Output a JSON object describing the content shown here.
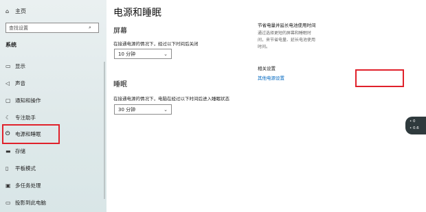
{
  "sidebar": {
    "home": "主页",
    "search_placeholder": "查找设置",
    "section": "系统",
    "items": [
      {
        "label": "显示"
      },
      {
        "label": "声音"
      },
      {
        "label": "通知和操作"
      },
      {
        "label": "专注助手"
      },
      {
        "label": "电源和睡眠"
      },
      {
        "label": "存储"
      },
      {
        "label": "平板模式"
      },
      {
        "label": "多任务处理"
      },
      {
        "label": "投影到此电脑"
      }
    ]
  },
  "main": {
    "title": "电源和睡眠",
    "screen": {
      "heading": "屏幕",
      "label": "在接通电源的情况下，经过以下时间后关闭",
      "value": "10 分钟"
    },
    "sleep": {
      "heading": "睡眠",
      "label": "在接通电源的情况下，电脑在经过以下时间后进入睡眠状态",
      "value": "30 分钟"
    }
  },
  "related": {
    "tip_title": "节省电量并延长电池使用时间",
    "tip_desc": "通过选择更短的屏幕和睡眠时间，来节省电量、延长电池使用时间。",
    "settings_title": "相关设置",
    "link": "其他电源设置"
  },
  "network": {
    "upload": "0",
    "download": "0.6"
  },
  "colors": {
    "accent": "#0067c0",
    "highlight": "#e0202a"
  }
}
